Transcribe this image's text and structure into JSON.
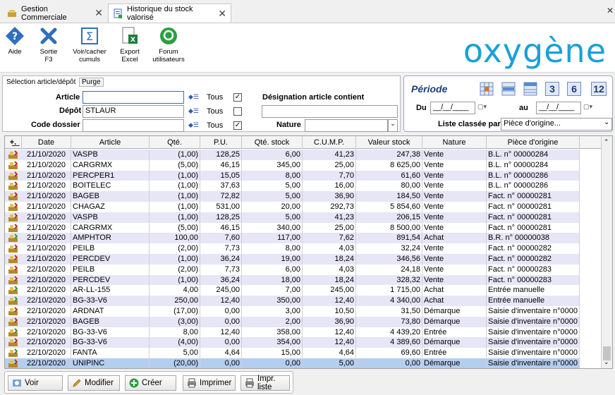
{
  "tabs": [
    {
      "label": "Gestion Commerciale",
      "close": "✕"
    },
    {
      "label": "Historique du stock valorisé",
      "close": "✕"
    }
  ],
  "window_close": "✕",
  "ribbon": [
    {
      "label": "Aide",
      "icon": "help-icon"
    },
    {
      "label": "Sortie F3",
      "icon": "exit-icon"
    },
    {
      "label": "Voir/cacher cumuls",
      "icon": "sum-icon"
    },
    {
      "label": "Export Excel",
      "icon": "excel-export-icon"
    },
    {
      "label": "Forum utilisateurs",
      "icon": "forum-icon"
    }
  ],
  "logo": "oxygène",
  "filters": {
    "section_label": "Sélection article/dépôt",
    "purge_label": "Purge",
    "article_label": "Article",
    "article_value": "",
    "depot_label": "Dépôt",
    "depot_value": "STLAUR",
    "dossier_label": "Code dossier",
    "dossier_value": "",
    "tous_label": "Tous",
    "tous_article_checked": true,
    "tous_depot_checked": false,
    "tous_dossier_checked": true,
    "designation_label": "Désignation article contient",
    "designation_value": "",
    "nature_label": "Nature",
    "nature_value": ""
  },
  "periode": {
    "title": "Période",
    "du_label": "Du",
    "du_value": "__/__/____",
    "au_label": "au",
    "au_value": "__/__/____",
    "liste_label": "Liste classée par",
    "liste_value": "Pièce d'origine...",
    "quick_buttons": [
      "3",
      "6",
      "12"
    ]
  },
  "grid": {
    "headers": [
      "Date",
      "Article",
      "Qté.",
      "P.U.",
      "Qté. stock",
      "C.U.M.P.",
      "Valeur stock",
      "Nature",
      "Pièce d'origine"
    ],
    "rows": [
      [
        "21/10/2020",
        "VASPB",
        "(1,00)",
        "128,25",
        "6,00",
        "41,23",
        "247,38",
        "Vente",
        "B.L. n° 00000284"
      ],
      [
        "21/10/2020",
        "CARGRMX",
        "(5,00)",
        "46,15",
        "345,00",
        "25,00",
        "8 625,00",
        "Vente",
        "B.L. n° 00000284"
      ],
      [
        "21/10/2020",
        "PERCPER1",
        "(1,00)",
        "15,05",
        "8,00",
        "7,70",
        "61,60",
        "Vente",
        "B.L. n° 00000286"
      ],
      [
        "21/10/2020",
        "BOITELEC",
        "(1,00)",
        "37,63",
        "5,00",
        "16,00",
        "80,00",
        "Vente",
        "B.L. n° 00000286"
      ],
      [
        "21/10/2020",
        "BAGEB",
        "(1,00)",
        "72,82",
        "5,00",
        "36,90",
        "184,50",
        "Vente",
        "Fact. n° 00000281"
      ],
      [
        "21/10/2020",
        "CHAGAZ",
        "(1,00)",
        "531,00",
        "20,00",
        "292,73",
        "5 854,60",
        "Vente",
        "Fact. n° 00000281"
      ],
      [
        "21/10/2020",
        "VASPB",
        "(1,00)",
        "128,25",
        "5,00",
        "41,23",
        "206,15",
        "Vente",
        "Fact. n° 00000281"
      ],
      [
        "21/10/2020",
        "CARGRMX",
        "(5,00)",
        "46,15",
        "340,00",
        "25,00",
        "8 500,00",
        "Vente",
        "Fact. n° 00000281"
      ],
      [
        "21/10/2020",
        "AMPHTOR",
        "100,00",
        "7,60",
        "117,00",
        "7,62",
        "891,54",
        "Achat",
        "B.R. n° 00000038"
      ],
      [
        "21/10/2020",
        "PEILB",
        "(2,00)",
        "7,73",
        "8,00",
        "4,03",
        "32,24",
        "Vente",
        "Fact. n° 00000282"
      ],
      [
        "21/10/2020",
        "PERCDEV",
        "(1,00)",
        "36,24",
        "19,00",
        "18,24",
        "346,56",
        "Vente",
        "Fact. n° 00000282"
      ],
      [
        "22/10/2020",
        "PEILB",
        "(2,00)",
        "7,73",
        "6,00",
        "4,03",
        "24,18",
        "Vente",
        "Fact. n° 00000283"
      ],
      [
        "22/10/2020",
        "PERCDEV",
        "(1,00)",
        "36,24",
        "18,00",
        "18,24",
        "328,32",
        "Vente",
        "Fact. n° 00000283"
      ],
      [
        "22/10/2020",
        "AR-LL-155",
        "4,00",
        "245,00",
        "7,00",
        "245,00",
        "1 715,00",
        "Achat",
        "Entrée manuelle"
      ],
      [
        "22/10/2020",
        "BG-33-V6",
        "250,00",
        "12,40",
        "350,00",
        "12,40",
        "4 340,00",
        "Achat",
        "Entrée manuelle"
      ],
      [
        "22/10/2020",
        "ARDNAT",
        "(17,00)",
        "0,00",
        "3,00",
        "10,50",
        "31,50",
        "Démarque",
        "Saisie d'inventaire n°0000"
      ],
      [
        "22/10/2020",
        "BAGEB",
        "(3,00)",
        "0,00",
        "2,00",
        "36,90",
        "73,80",
        "Démarque",
        "Saisie d'inventaire n°0000"
      ],
      [
        "22/10/2020",
        "BG-33-V6",
        "8,00",
        "12,40",
        "358,00",
        "12,40",
        "4 439,20",
        "Entrée",
        "Saisie d'inventaire n°0000"
      ],
      [
        "22/10/2020",
        "BG-33-V6",
        "(4,00)",
        "0,00",
        "354,00",
        "12,40",
        "4 389,60",
        "Démarque",
        "Saisie d'inventaire n°0000"
      ],
      [
        "22/10/2020",
        "FANTA",
        "5,00",
        "4,64",
        "15,00",
        "4,64",
        "69,60",
        "Entrée",
        "Saisie d'inventaire n°0000"
      ],
      [
        "22/10/2020",
        "UNIPINC",
        "(20,00)",
        "0,00",
        "0,00",
        "5,00",
        "0,00",
        "Démarque",
        "Saisie d'inventaire n°0000"
      ]
    ],
    "selected_row": 20,
    "row_colors": {
      "even": "#ffffff",
      "odd": "#e6e6f6",
      "selected": "#b4cef0"
    }
  },
  "footer": [
    {
      "label": "Voir",
      "icon": "view-icon"
    },
    {
      "label": "Modifier",
      "icon": "pencil-icon"
    },
    {
      "label": "Créer",
      "icon": "plus-icon"
    },
    {
      "label": "Imprimer",
      "icon": "printer-icon"
    },
    {
      "label": "Impr. liste",
      "icon": "print-list-icon"
    }
  ],
  "colors": {
    "accent": "#1aa0d8",
    "title_blue": "#1e3c78"
  }
}
